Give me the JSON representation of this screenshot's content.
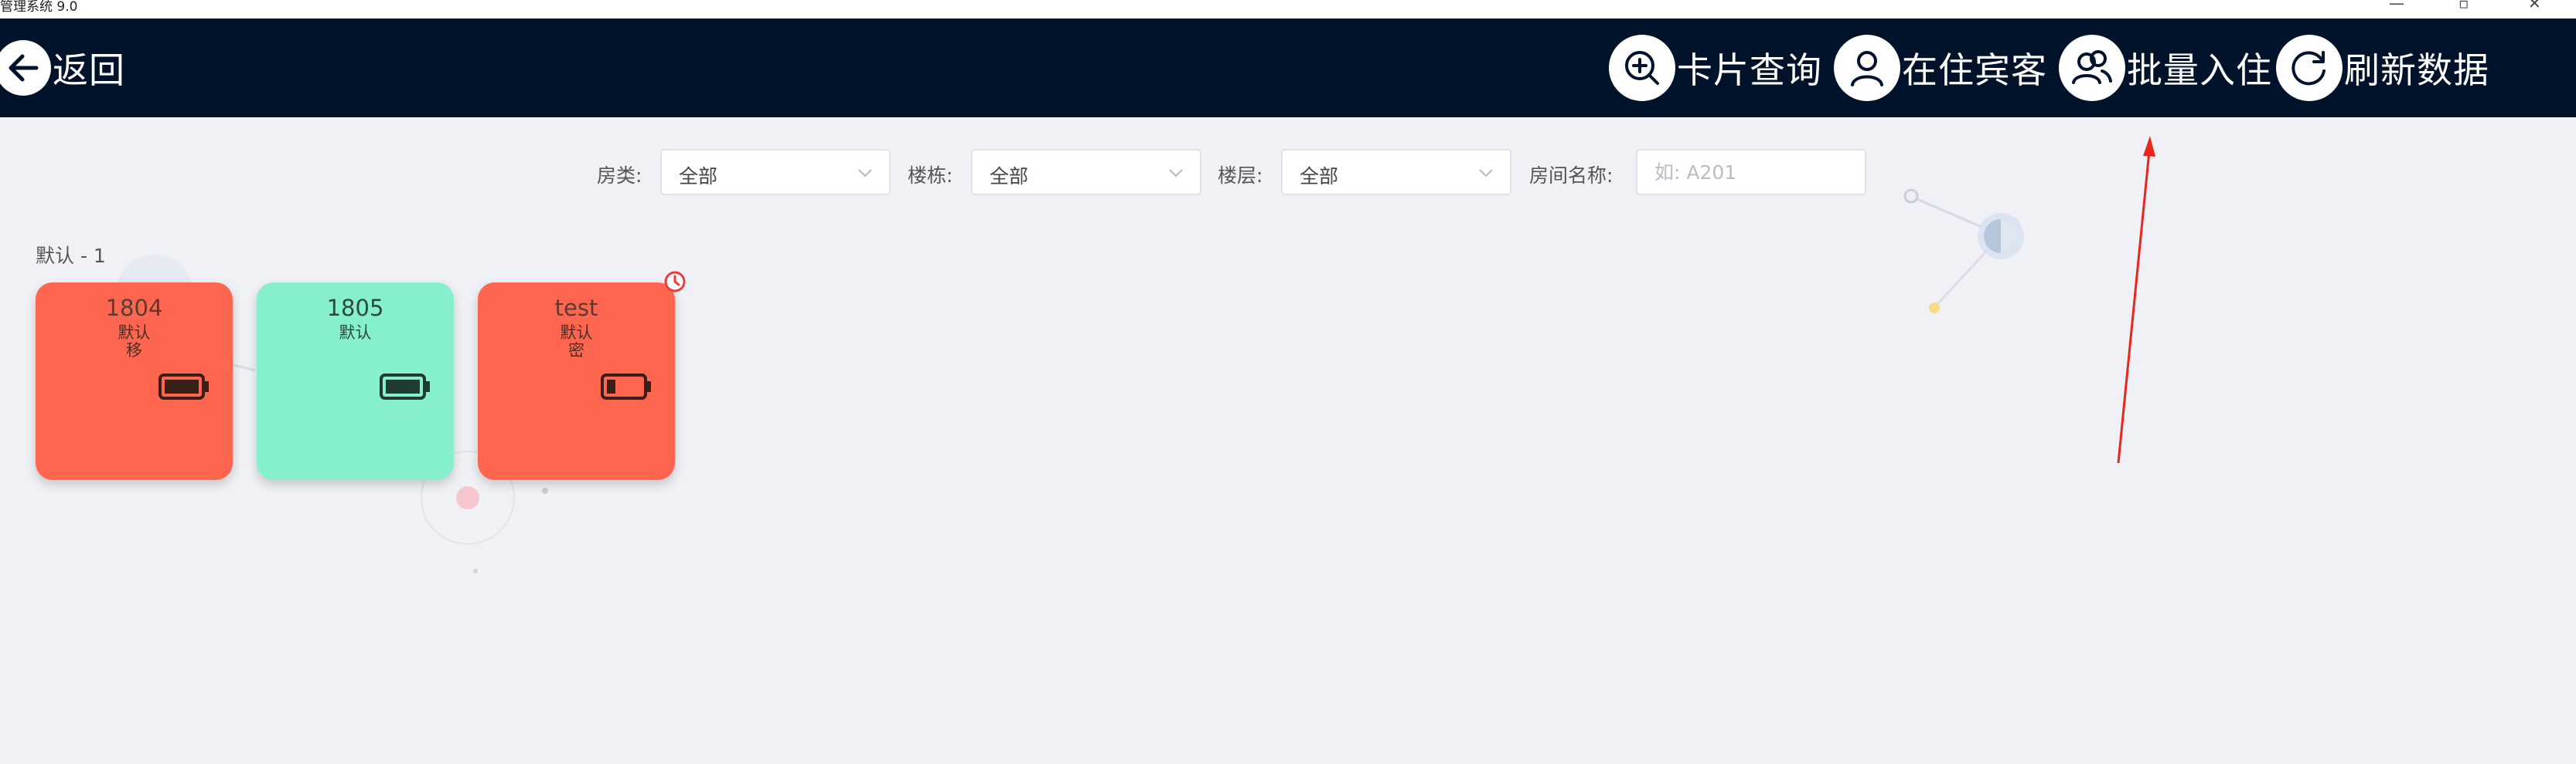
{
  "window": {
    "title": "管理系统 9.0",
    "controls": [
      "—",
      "▫",
      "✕"
    ]
  },
  "header": {
    "back_label": "返回",
    "actions": [
      {
        "label": "卡片查询",
        "icon": "zoom-in-icon"
      },
      {
        "label": "在住宾客",
        "icon": "user-icon"
      },
      {
        "label": "批量入住",
        "icon": "users-icon"
      },
      {
        "label": "刷新数据",
        "icon": "refresh-icon"
      }
    ]
  },
  "filters": {
    "room_type": {
      "label": "房类:",
      "value": "全部"
    },
    "building": {
      "label": "楼栋:",
      "value": "全部"
    },
    "floor": {
      "label": "楼层:",
      "value": "全部"
    },
    "room_name": {
      "label": "房间名称:",
      "placeholder": "如: A201"
    }
  },
  "group": {
    "title": "默认 - 1"
  },
  "rooms": [
    {
      "number": "1804",
      "type": "默认",
      "status": "移",
      "color": "#ff6650",
      "battery": 1.0
    },
    {
      "number": "1805",
      "type": "默认",
      "status": "",
      "color": "#86f0cc",
      "battery": 1.0
    },
    {
      "number": "test",
      "type": "默认",
      "status": "密",
      "color": "#ff6650",
      "battery": 0.25
    }
  ],
  "colors": {
    "header_bg": "#01132b",
    "page_bg": "#f0f1f6",
    "annotation_arrow": "#e8261c"
  }
}
